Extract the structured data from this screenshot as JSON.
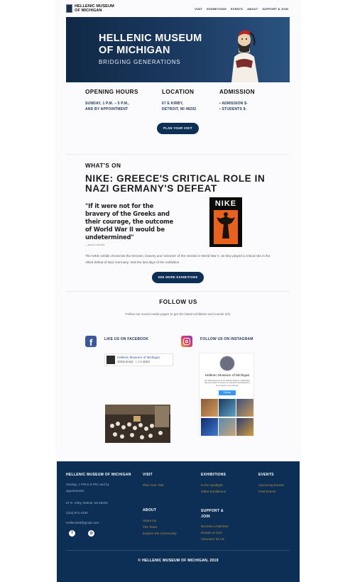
{
  "header": {
    "logo_line1": "HELLENIC MUSEUM",
    "logo_line2": "OF MICHIGAN",
    "nav": [
      "VISIT",
      "EXHIBITIONS",
      "EVENTS",
      "ABOUT",
      "SUPPORT & JOIN"
    ]
  },
  "banner": {
    "title_line1": "HELLENIC MUSEUM",
    "title_line2": "OF MICHIGAN",
    "subtitle": "BRIDGING GENERATIONS"
  },
  "info": {
    "hours_heading": "OPENING HOURS",
    "hours_line1": "SUNDAY, 1 P.M. – 5 P.M.,",
    "hours_line2": "AND BY APPOINTMENT",
    "location_heading": "LOCATION",
    "location_line1": "67 E KIRBY,",
    "location_line2": "DETROIT, MI 48202",
    "admission_heading": "ADMISSION",
    "admission_line1": "• ADMISSION $-",
    "admission_line2": "• STUDENTS $-",
    "plan_button": "PLAN YOUR VISIT"
  },
  "whats_on": {
    "heading": "WHAT'S ON",
    "title": "NIKE: GREECE'S CRITICAL ROLE IN NAZI GERMANY'S DEFEAT",
    "quote": "\"If it were not for the bravery of the Greeks and their courage, the outcome of World War II would be undetermined\"",
    "quote_attr": "— Winston Churchill",
    "poster_label": "NIKE",
    "body": "The NIKE exhibit chronicles the heroism, bravery and 'victories' of the Greeks in World War II, as they played a critical role in the Allied defeat of Nazi Germany. Visit the last days of the exhibition.",
    "more_button": "SEE MORE EXHIBITIONS"
  },
  "follow": {
    "heading": "FOLLOW US",
    "text": "Follow our social media pages to get the latest exhibition and events info.",
    "facebook_label": "LIKE US ON FACEBOOK",
    "instagram_label": "FOLLOW US ON INSTAGRAM",
    "fb_page_name": "Hellenic Museum of Michigan",
    "fb_page_meta": "博物館/美術館 · 1,235 個讚好",
    "ig_name": "Hellenic Museum of Michigan",
    "ig_bio": "The official account of the Hellenic Museum of Michigan. Tag your photos of Greece or Greek life with #hellenicmi for a chance to be featured!",
    "ig_follow": "Follow"
  },
  "footer": {
    "brand_heading": "HELLENIC MUSEUM OF MICHIGAN",
    "hours": "Sunday, 1 PM to 5 PM, and by appointment.",
    "address": "67 E. Kirby, Detroit, MI 48202",
    "phone": "(313) 871-4100",
    "email": "HellenicMI@gmail.com",
    "visit_heading": "VISIT",
    "visit_links": [
      "Plan Your Visit"
    ],
    "exhibitions_heading": "EXHIBITIONS",
    "exhibitions_links": [
      "In the Spotlight",
      "Other Exhibitions"
    ],
    "events_heading": "EVENTS",
    "events_links": [
      "Upcoming Events",
      "Past Events"
    ],
    "about_heading": "ABOUT",
    "about_links": [
      "About Us",
      "The Team",
      "Explore the Community"
    ],
    "support_heading_line1": "SUPPORT &",
    "support_heading_line2": "JOIN",
    "support_links": [
      "Become a Member",
      "Donate & Give",
      "Volunteer for Us"
    ],
    "copyright": "© HELLENIC MUSEUM OF MICHIGAN,  2019"
  },
  "colors": {
    "navy": "#0d2e55",
    "gold_link": "#b58f3e",
    "facebook": "#3b5998"
  }
}
